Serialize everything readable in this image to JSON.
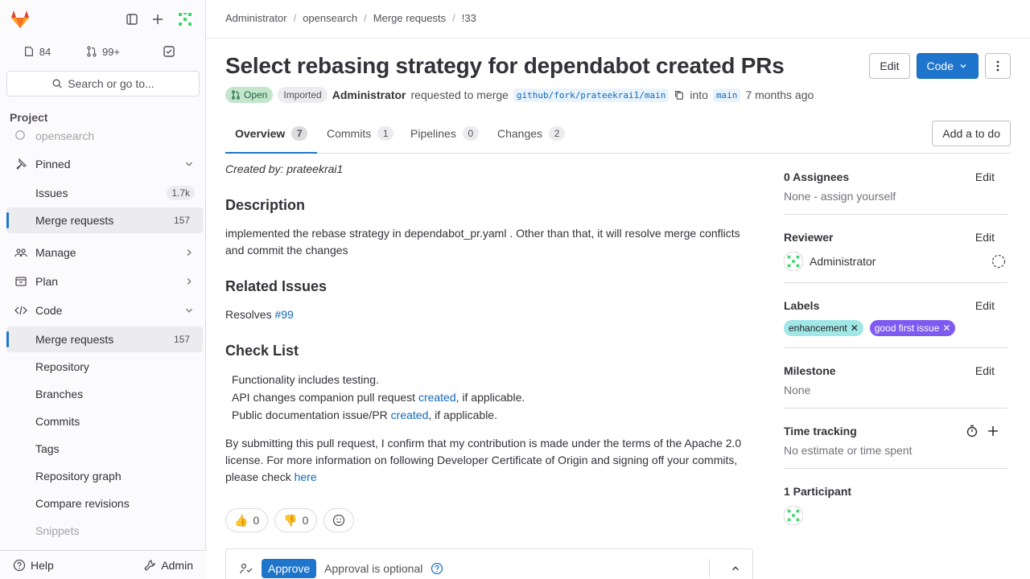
{
  "sidebar": {
    "counts": {
      "issues": "84",
      "merge_requests": "99+"
    },
    "search_label": "Search or go to...",
    "section_label": "Project",
    "project_name": "opensearch",
    "items": {
      "pinned": "Pinned",
      "issues": "Issues",
      "issues_count": "1.7k",
      "merge_requests_pinned": "Merge requests",
      "merge_requests_pinned_count": "157",
      "manage": "Manage",
      "plan": "Plan",
      "code": "Code",
      "code_merge_requests": "Merge requests",
      "code_merge_requests_count": "157",
      "repository": "Repository",
      "branches": "Branches",
      "commits": "Commits",
      "tags": "Tags",
      "repository_graph": "Repository graph",
      "compare_revisions": "Compare revisions",
      "snippets": "Snippets"
    },
    "help": "Help",
    "admin": "Admin"
  },
  "breadcrumb": [
    "Administrator",
    "opensearch",
    "Merge requests",
    "!33"
  ],
  "mr": {
    "title": "Select rebasing strategy for dependabot created PRs",
    "edit_label": "Edit",
    "code_label": "Code",
    "status": "Open",
    "imported": "Imported",
    "author": "Administrator",
    "requested_text": "requested to merge",
    "source_branch": "github/fork/prateekrai1/main",
    "into_text": "into",
    "target_branch": "main",
    "time_ago": "7 months ago"
  },
  "tabs": [
    {
      "label": "Overview",
      "count": "7"
    },
    {
      "label": "Commits",
      "count": "1"
    },
    {
      "label": "Pipelines",
      "count": "0"
    },
    {
      "label": "Changes",
      "count": "2"
    }
  ],
  "todo_label": "Add a to do",
  "description": {
    "created_by": "Created by: prateekrai1",
    "h_description": "Description",
    "body": "implemented the rebase strategy in dependabot_pr.yaml . Other than that, it will resolve merge conflicts and commit the changes",
    "h_related": "Related Issues",
    "resolves_text": "Resolves",
    "resolves_link": "#99",
    "h_checklist": "Check List",
    "check1": "Functionality includes testing.",
    "check2_pre": "API changes companion pull request",
    "check2_link": "created",
    "check2_post": ", if applicable.",
    "check3_pre": "Public documentation issue/PR",
    "check3_link": "created",
    "check3_post": ", if applicable.",
    "license": "By submitting this pull request, I confirm that my contribution is made under the terms of the Apache 2.0 license. For more information on following Developer Certificate of Origin and signing off your commits, please check",
    "license_link": "here"
  },
  "reactions": {
    "thumbs_up": "0",
    "thumbs_down": "0"
  },
  "approval": {
    "button": "Approve",
    "text": "Approval is optional"
  },
  "right_sidebar": {
    "assignees_title": "0 Assignees",
    "assignees_value": "None - assign yourself",
    "reviewer_title": "Reviewer",
    "reviewer_name": "Administrator",
    "labels_title": "Labels",
    "labels": [
      {
        "text": "enhancement",
        "bg": "#a0e7e5",
        "fg": "#1f1e24"
      },
      {
        "text": "good first issue",
        "bg": "#7f5af0",
        "fg": "#ffffff"
      }
    ],
    "milestone_title": "Milestone",
    "milestone_value": "None",
    "time_title": "Time tracking",
    "time_value": "No estimate or time spent",
    "participants_title": "1 Participant",
    "edit": "Edit"
  },
  "colors": {
    "accent": "#1f75cb",
    "open_badge": "#c3e6cd"
  }
}
